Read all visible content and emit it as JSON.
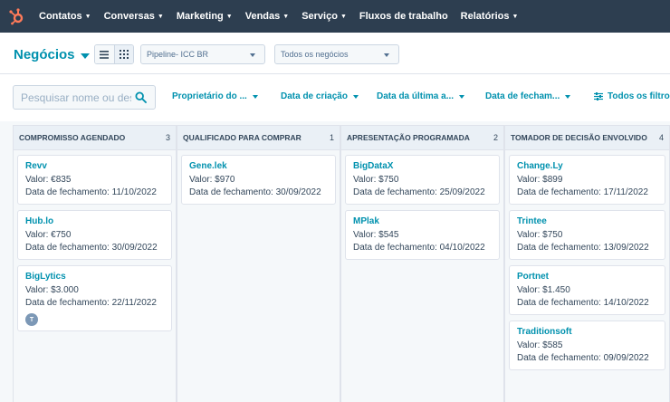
{
  "nav": {
    "items": [
      {
        "label": "Contatos"
      },
      {
        "label": "Conversas"
      },
      {
        "label": "Marketing"
      },
      {
        "label": "Vendas"
      },
      {
        "label": "Serviço"
      },
      {
        "label": "Fluxos de trabalho"
      },
      {
        "label": "Relatórios"
      }
    ]
  },
  "header": {
    "title": "Negócios",
    "pipeline": "Pipeline- ICC BR",
    "deals_filter": "Todos os negócios"
  },
  "search": {
    "placeholder": "Pesquisar nome ou des"
  },
  "filters": {
    "owner": "Proprietário do ...",
    "created": "Data de criação",
    "last": "Data da última a...",
    "close": "Data de fecham...",
    "all": "Todos os filtros"
  },
  "card_labels": {
    "value": "Valor:",
    "close_date": "Data de fechamento:"
  },
  "columns": [
    {
      "title": "COMPROMISSO AGENDADO",
      "count": "3",
      "cards": [
        {
          "name": "Revv",
          "value": "€835",
          "close": "11/10/2022"
        },
        {
          "name": "Hub.lo",
          "value": "€750",
          "close": "30/09/2022"
        },
        {
          "name": "BigLytics",
          "value": "$3.000",
          "close": "22/11/2022",
          "avatar": "T"
        }
      ]
    },
    {
      "title": "QUALIFICADO PARA COMPRAR",
      "count": "1",
      "cards": [
        {
          "name": "Gene.lek",
          "value": "$970",
          "close": "30/09/2022"
        }
      ]
    },
    {
      "title": "APRESENTAÇÃO PROGRAMADA",
      "count": "2",
      "cards": [
        {
          "name": "BigDataX",
          "value": "$750",
          "close": "25/09/2022"
        },
        {
          "name": "MPlak",
          "value": "$545",
          "close": "04/10/2022"
        }
      ]
    },
    {
      "title": "TOMADOR DE DECISÃO ENVOLVIDO",
      "count": "4",
      "cards": [
        {
          "name": "Change.Ly",
          "value": "$899",
          "close": "17/11/2022"
        },
        {
          "name": "Trintee",
          "value": "$750",
          "close": "13/09/2022"
        },
        {
          "name": "Portnet",
          "value": "$1.450",
          "close": "14/10/2022"
        },
        {
          "name": "Traditionsoft",
          "value": "$585",
          "close": "09/09/2022"
        }
      ]
    }
  ]
}
